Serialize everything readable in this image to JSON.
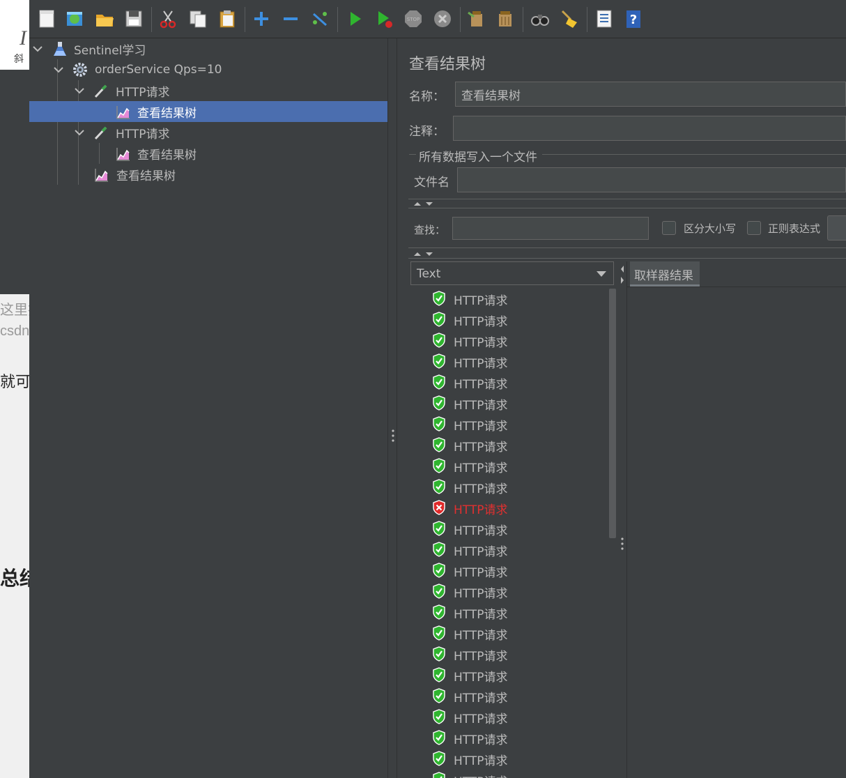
{
  "background_page": {
    "fragments": [
      "I",
      "斜",
      "这里插",
      "csdn",
      "就可",
      "总结"
    ]
  },
  "tree": {
    "items": [
      {
        "label": "Sentinel学习",
        "icon": "flask-icon",
        "expanded": true
      },
      {
        "label": "orderService Qps=10",
        "icon": "gear-icon",
        "expanded": true
      },
      {
        "label": "HTTP请求",
        "icon": "pipette-icon",
        "expanded": true
      },
      {
        "label": "查看结果树",
        "icon": "graph-icon",
        "selected": true
      },
      {
        "label": "HTTP请求",
        "icon": "pipette-icon",
        "expanded": true
      },
      {
        "label": "查看结果树",
        "icon": "graph-icon"
      },
      {
        "label": "查看结果树",
        "icon": "graph-icon"
      }
    ]
  },
  "panel": {
    "title": "查看结果树",
    "name_label": "名称：",
    "name_value": "查看结果树",
    "comment_label": "注释：",
    "comment_value": "",
    "file_section_label": "所有数据写入一个文件",
    "filename_label": "文件名",
    "filename_value": "",
    "search_label": "查找：",
    "search_value": "",
    "case_sensitive_label": "区分大小写",
    "regex_label": "正则表达式",
    "renderer_selected": "Text",
    "sampler_tab": "取样器结果"
  },
  "results": {
    "items": [
      {
        "label": "HTTP请求",
        "status": "success"
      },
      {
        "label": "HTTP请求",
        "status": "success"
      },
      {
        "label": "HTTP请求",
        "status": "success"
      },
      {
        "label": "HTTP请求",
        "status": "success"
      },
      {
        "label": "HTTP请求",
        "status": "success"
      },
      {
        "label": "HTTP请求",
        "status": "success"
      },
      {
        "label": "HTTP请求",
        "status": "success"
      },
      {
        "label": "HTTP请求",
        "status": "success"
      },
      {
        "label": "HTTP请求",
        "status": "success"
      },
      {
        "label": "HTTP请求",
        "status": "success"
      },
      {
        "label": "HTTP请求",
        "status": "error"
      },
      {
        "label": "HTTP请求",
        "status": "success"
      },
      {
        "label": "HTTP请求",
        "status": "success"
      },
      {
        "label": "HTTP请求",
        "status": "success"
      },
      {
        "label": "HTTP请求",
        "status": "success"
      },
      {
        "label": "HTTP请求",
        "status": "success"
      },
      {
        "label": "HTTP请求",
        "status": "success"
      },
      {
        "label": "HTTP请求",
        "status": "success"
      },
      {
        "label": "HTTP请求",
        "status": "success"
      },
      {
        "label": "HTTP请求",
        "status": "success"
      },
      {
        "label": "HTTP请求",
        "status": "success"
      },
      {
        "label": "HTTP请求",
        "status": "success"
      },
      {
        "label": "HTTP请求",
        "status": "success"
      },
      {
        "label": "HTTP请求",
        "status": "success"
      }
    ]
  },
  "toolbar": {
    "icons": [
      "new-icon",
      "templates-icon",
      "open-icon",
      "save-icon",
      "cut-icon",
      "copy-icon",
      "paste-icon",
      "expand-icon",
      "collapse-icon",
      "toggle-icon",
      "start-icon",
      "start-no-pause-icon",
      "stop-icon",
      "shutdown-icon",
      "clear-icon",
      "clear-all-icon",
      "search-icon",
      "reset-search-icon",
      "function-helper-icon",
      "help-icon"
    ]
  },
  "colors": {
    "background": "#3c3f41",
    "selection": "#4b6eaf",
    "text": "#bbbbbb",
    "success": "#2fb52f",
    "error": "#e02a2a",
    "error_text": "#e03030"
  }
}
